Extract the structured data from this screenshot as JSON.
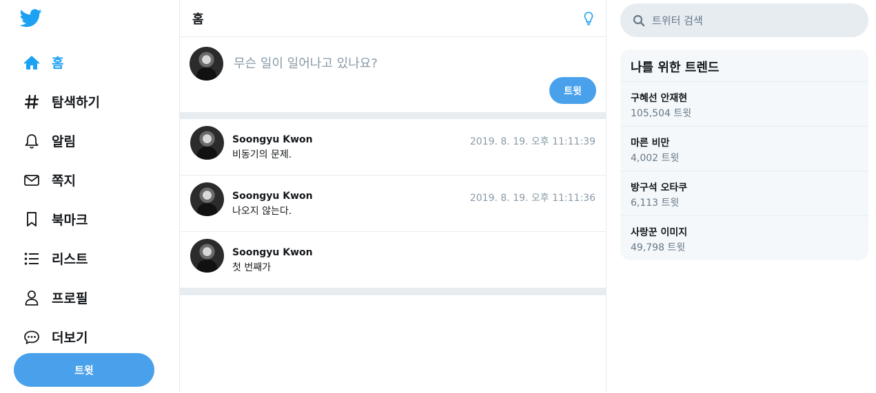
{
  "sidebar": {
    "items": [
      {
        "label": "홈",
        "icon": "home-icon"
      },
      {
        "label": "탐색하기",
        "icon": "hashtag-icon"
      },
      {
        "label": "알림",
        "icon": "bell-icon"
      },
      {
        "label": "쪽지",
        "icon": "mail-icon"
      },
      {
        "label": "북마크",
        "icon": "bookmark-icon"
      },
      {
        "label": "리스트",
        "icon": "list-icon"
      },
      {
        "label": "프로필",
        "icon": "user-icon"
      },
      {
        "label": "더보기",
        "icon": "more-bubble-icon"
      }
    ],
    "tweet_button": "트윗"
  },
  "main": {
    "title": "홈",
    "composer": {
      "placeholder": "무슨 일이 일어나고 있나요?",
      "button": "트윗"
    },
    "tweets": [
      {
        "author": "Soongyu Kwon",
        "time": "2019. 8. 19. 오후 11:11:39",
        "text": "비동기의 문제."
      },
      {
        "author": "Soongyu Kwon",
        "time": "2019. 8. 19. 오후 11:11:36",
        "text": "나오지 않는다."
      },
      {
        "author": "Soongyu Kwon",
        "time": "",
        "text": "첫 번째가"
      }
    ]
  },
  "right": {
    "search_placeholder": "트위터 검색",
    "trends_title": "나를 위한 트렌드",
    "trends": [
      {
        "name": "구혜선 안재현",
        "count": "105,504 트윗"
      },
      {
        "name": "마른 비만",
        "count": "4,002 트윗"
      },
      {
        "name": "방구석 오타쿠",
        "count": "6,113 트윗"
      },
      {
        "name": "사랑꾼 이미지",
        "count": "49,798 트윗"
      }
    ]
  },
  "colors": {
    "accent": "#1da1f2",
    "button": "#4aa1eb",
    "border": "#e6ecf0",
    "muted": "#8899a6"
  }
}
